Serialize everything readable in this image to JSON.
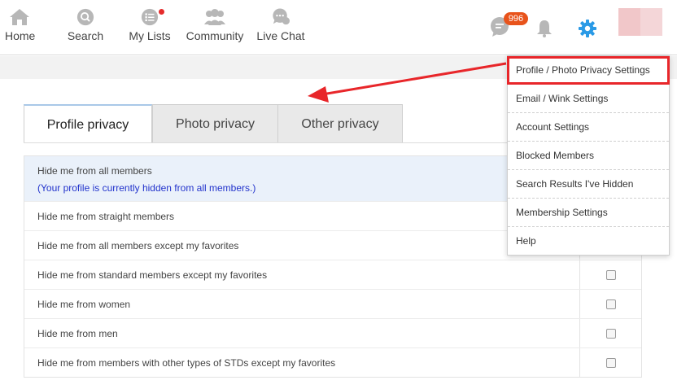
{
  "nav": {
    "items": [
      {
        "label": "Home",
        "icon": "home-icon"
      },
      {
        "label": "Search",
        "icon": "search-icon"
      },
      {
        "label": "My Lists",
        "icon": "list-icon"
      },
      {
        "label": "Community",
        "icon": "people-icon"
      },
      {
        "label": "Live Chat",
        "icon": "chat-bubbles-icon"
      }
    ],
    "message_count": "996",
    "icons": {
      "messages": "message-icon",
      "notifications": "bell-icon",
      "settings": "gear-icon"
    },
    "colors": {
      "icon_grey": "#b7b7b7",
      "settings_blue": "#2a9ae6",
      "badge": "#e8531b",
      "dot": "#e52b2b"
    }
  },
  "tabs": [
    {
      "label": "Profile privacy",
      "active": true
    },
    {
      "label": "Photo privacy",
      "active": false
    },
    {
      "label": "Other privacy",
      "active": false
    }
  ],
  "privacy_rows": [
    {
      "label": "Hide me from all members",
      "note": "(Your profile is currently hidden from all members.)",
      "checked": false
    },
    {
      "label": "Hide me from straight members",
      "checked": false
    },
    {
      "label": "Hide me from all members except my favorites",
      "checked": false
    },
    {
      "label": "Hide me from standard members except my favorites",
      "checked": false
    },
    {
      "label": "Hide me from women",
      "checked": false
    },
    {
      "label": "Hide me from men",
      "checked": false
    },
    {
      "label": "Hide me from members with other types of STDs except my favorites",
      "checked": false
    }
  ],
  "dropdown": {
    "items": [
      {
        "label": "Profile / Photo Privacy Settings",
        "selected": true
      },
      {
        "label": "Email / Wink Settings"
      },
      {
        "label": "Account Settings"
      },
      {
        "label": "Blocked Members"
      },
      {
        "label": "Search Results I've Hidden"
      },
      {
        "label": "Membership Settings"
      },
      {
        "label": "Help"
      }
    ],
    "highlight_color": "#e8262a"
  }
}
